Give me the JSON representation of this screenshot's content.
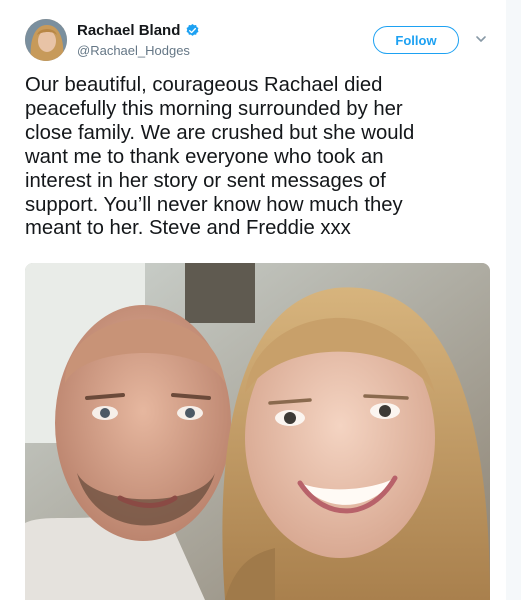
{
  "user": {
    "display_name": "Rachael Bland",
    "handle": "@Rachael_Hodges",
    "verified": true,
    "avatar_icon": "profile-photo-icon"
  },
  "actions": {
    "follow_label": "Follow",
    "more_icon": "chevron-down-icon"
  },
  "tweet": {
    "text": "Our beautiful, courageous Rachael died\npeacefully this morning surrounded by her\nclose family. We are crushed but she would\nwant me to thank everyone who took an\ninterest in her story or sent messages of\nsupport. You’ll never know how much they\nmeant to her. Steve and Freddie xxx"
  },
  "colors": {
    "accent": "#1da1f2",
    "text": "#14171a",
    "secondary_text": "#657786"
  }
}
